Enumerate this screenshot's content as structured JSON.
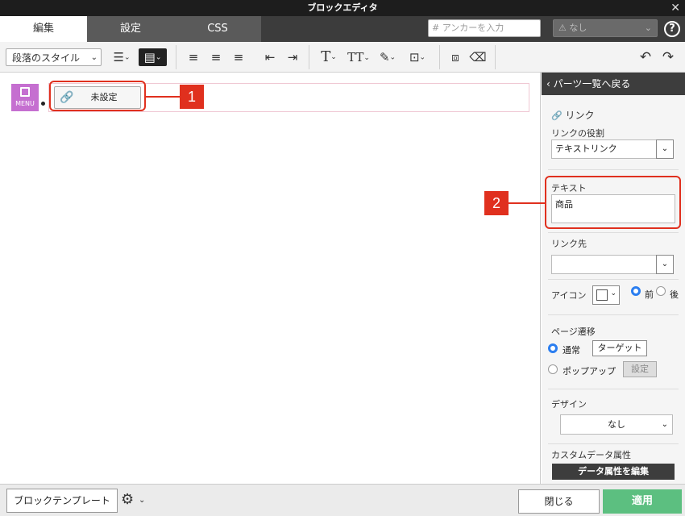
{
  "window": {
    "title": "ブロックエディタ",
    "close": "✕"
  },
  "tabs": [
    {
      "label": "編集",
      "active": true
    },
    {
      "label": "設定",
      "active": false
    },
    {
      "label": "CSS",
      "active": false
    }
  ],
  "header": {
    "anchor_prefix": "#",
    "anchor_placeholder": "アンカーを入力",
    "select_icon": "⚠",
    "select_value": "なし",
    "help": "?"
  },
  "toolbar": {
    "paragraph_style": "段落のスタイル",
    "icons": {
      "list": "☰",
      "align_block": "▤",
      "align_left": "≡",
      "align_center": "≡",
      "align_right": "≡",
      "outdent": "⇤",
      "indent": "⇥",
      "text_size": "T",
      "text_style": "TT",
      "color": "✎",
      "frame": "⊡",
      "split": "⧈",
      "clear": "⌫",
      "undo": "↶",
      "redo": "↷",
      "chevron": "⌄"
    }
  },
  "editor": {
    "menu_badge": "MENU",
    "link_button": "未設定",
    "link_icon": "🔗",
    "callout_1": "1",
    "callout_2": "2"
  },
  "panel": {
    "back": "‹ パーツ一覧へ戻る",
    "section_title": "リンク",
    "link_role_label": "リンクの役割",
    "link_role_value": "テキストリンク",
    "text_label": "テキスト",
    "text_value": "商品",
    "link_target_label": "リンク先",
    "link_target_value": "",
    "icon_label": "アイコン",
    "icon_pos_before": "前",
    "icon_pos_after": "後",
    "page_transition_label": "ページ遷移",
    "normal": "通常",
    "target_button": "ターゲット",
    "popup": "ポップアップ",
    "settings_button": "設定",
    "design_label": "デザイン",
    "design_value": "なし",
    "custom_data_label": "カスタムデータ属性",
    "edit_attr_button": "データ属性を編集"
  },
  "footer": {
    "template_button": "ブロックテンプレート",
    "gear": "⚙",
    "close_button": "閉じる",
    "apply_button": "適用"
  },
  "colors": {
    "accent_red": "#e0301e",
    "apply_green": "#5cbf80",
    "radio_blue": "#2b7ef0",
    "menu_purple": "#c56fd0"
  }
}
